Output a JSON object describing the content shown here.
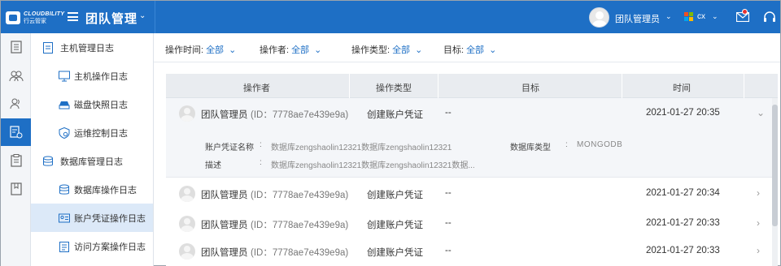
{
  "header": {
    "logo_en": "CLOUDBILITY",
    "logo_cn": "行云管家",
    "team_title": "团队管理",
    "user_name": "团队管理员",
    "region": "cx"
  },
  "colors": {
    "primary": "#1e6fc5",
    "active_bg": "#dce9f8"
  },
  "rail": {
    "items": [
      {
        "icon": "document-icon"
      },
      {
        "icon": "team-icon"
      },
      {
        "icon": "user-icon"
      },
      {
        "icon": "log-settings-icon",
        "active": true
      },
      {
        "icon": "clipboard-icon"
      },
      {
        "icon": "book-icon"
      }
    ]
  },
  "submenu": {
    "host_group": "主机管理日志",
    "host_ops": "主机操作日志",
    "snapshot": "磁盘快照日志",
    "ops_control": "运维控制日志",
    "db_group": "数据库管理日志",
    "db_ops": "数据库操作日志",
    "credential": "账户凭证操作日志",
    "access_plan": "访问方案操作日志"
  },
  "filters": {
    "time_label": "操作时间:",
    "time_value": "全部",
    "operator_label": "操作者:",
    "operator_value": "全部",
    "type_label": "操作类型:",
    "type_value": "全部",
    "target_label": "目标:",
    "target_value": "全部"
  },
  "table": {
    "headers": {
      "operator": "操作者",
      "type": "操作类型",
      "target": "目标",
      "time": "时间"
    },
    "rows": [
      {
        "name": "团队管理员",
        "id": "(ID：7778ae7e439e9a)",
        "type": "创建账户凭证",
        "target": "--",
        "time": "2021-01-27 20:35",
        "arrow": "⌄"
      },
      {
        "name": "团队管理员",
        "id": "(ID：7778ae7e439e9a)",
        "type": "创建账户凭证",
        "target": "--",
        "time": "2021-01-27 20:34",
        "arrow": "›"
      },
      {
        "name": "团队管理员",
        "id": "(ID：7778ae7e439e9a)",
        "type": "创建账户凭证",
        "target": "--",
        "time": "2021-01-27 20:33",
        "arrow": "›"
      },
      {
        "name": "团队管理员",
        "id": "(ID：7778ae7e439e9a)",
        "type": "创建账户凭证",
        "target": "--",
        "time": "2021-01-27 20:33",
        "arrow": "›"
      }
    ],
    "detail": {
      "cred_name_label": "账户凭证名称",
      "cred_name_value": "数据库zengshaolin12321数据库zengshaolin12321",
      "db_type_label": "数据库类型",
      "db_type_value": "MONGODB",
      "desc_label": "描述",
      "desc_value": "数据库zengshaolin12321数据库zengshaolin12321数据...",
      "colon": ":"
    }
  }
}
